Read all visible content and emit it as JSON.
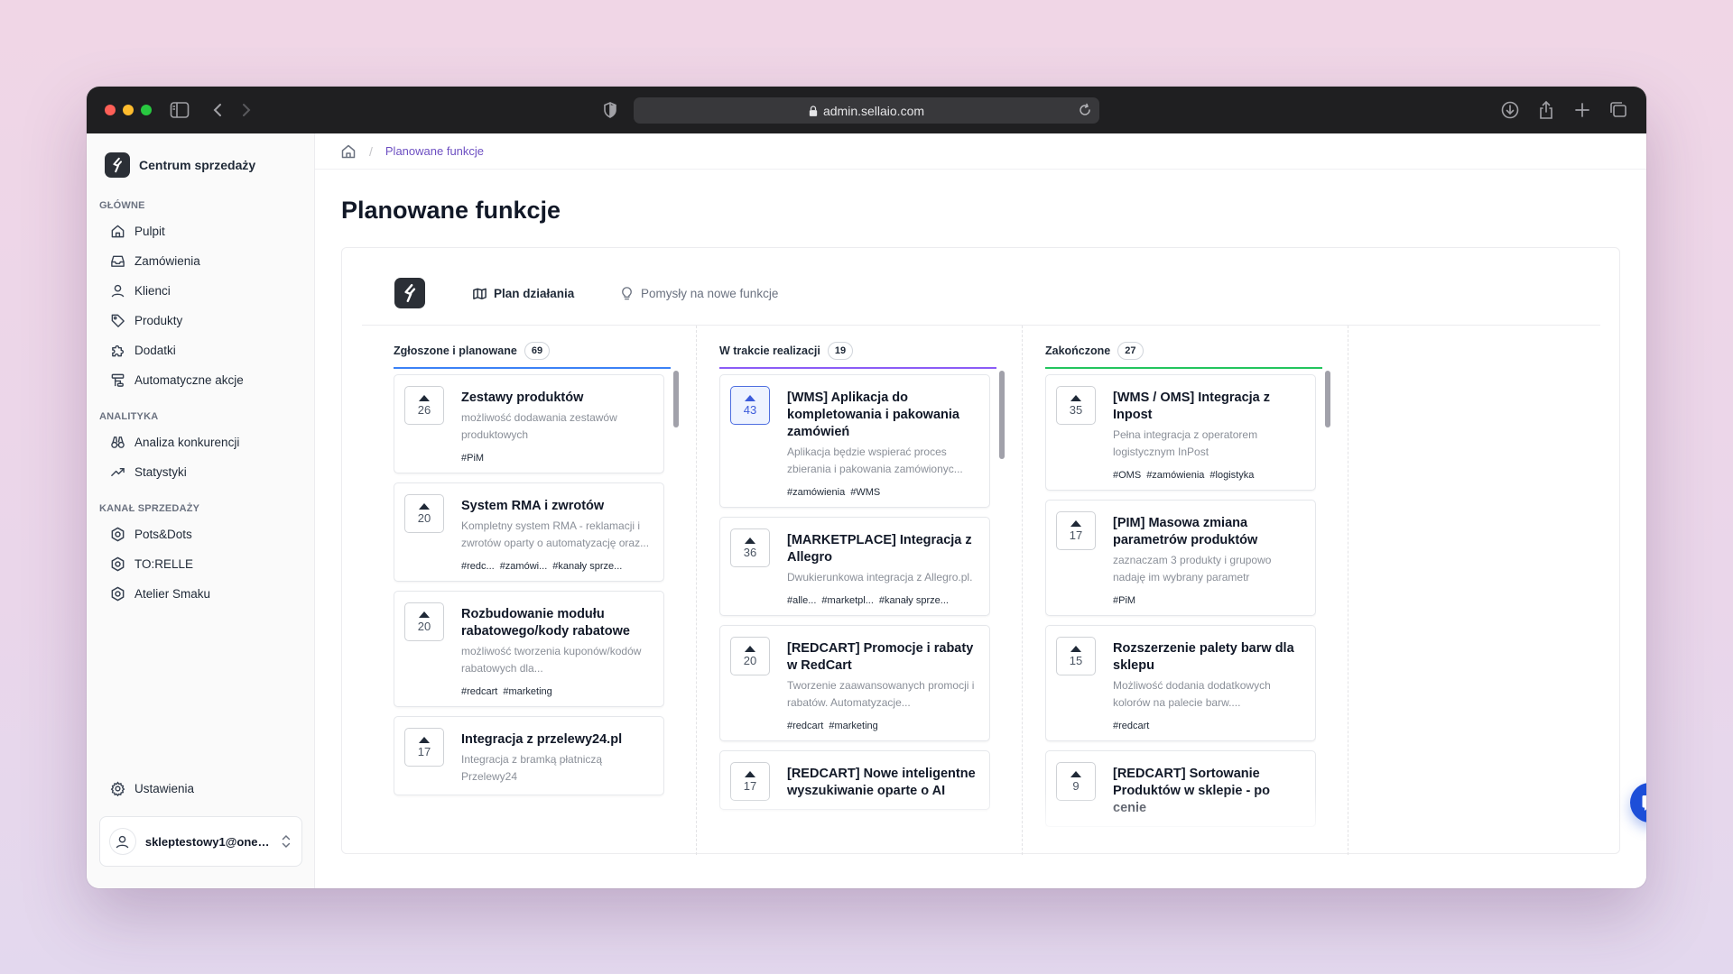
{
  "browser": {
    "url": "admin.sellaio.com"
  },
  "sidebar": {
    "brand": "Centrum sprzedaży",
    "sections": [
      {
        "label": "GŁÓWNE",
        "items": [
          {
            "label": "Pulpit",
            "icon": "home-icon"
          },
          {
            "label": "Zamówienia",
            "icon": "inbox-icon"
          },
          {
            "label": "Klienci",
            "icon": "user-icon"
          },
          {
            "label": "Produkty",
            "icon": "tag-icon"
          },
          {
            "label": "Dodatki",
            "icon": "puzzle-icon"
          },
          {
            "label": "Automatyczne akcje",
            "icon": "workflow-icon"
          }
        ]
      },
      {
        "label": "ANALITYKA",
        "items": [
          {
            "label": "Analiza konkurencji",
            "icon": "binoculars-icon"
          },
          {
            "label": "Statystyki",
            "icon": "trend-icon"
          }
        ]
      },
      {
        "label": "KANAŁ SPRZEDAŻY",
        "items": [
          {
            "label": "Pots&Dots",
            "icon": "channel-icon"
          },
          {
            "label": "TO:RELLE",
            "icon": "channel-icon"
          },
          {
            "label": "Atelier Smaku",
            "icon": "channel-icon"
          }
        ]
      }
    ],
    "settings": "Ustawienia",
    "user_email": "skleptestowy1@onet.pl"
  },
  "breadcrumb": {
    "current": "Planowane funkcje"
  },
  "page": {
    "title": "Planowane funkcje",
    "tabs": {
      "roadmap": "Plan działania",
      "ideas": "Pomysły na nowe funkcje"
    }
  },
  "columns": [
    {
      "title": "Zgłoszone i planowane",
      "count": "69",
      "accent": "#3b82f6",
      "cards": [
        {
          "votes": "26",
          "title": "Zestawy produktów",
          "desc": "możliwość dodawania zestawów produktowych",
          "tags": [
            "#PiM"
          ]
        },
        {
          "votes": "20",
          "title": "System RMA i zwrotów",
          "desc": "Kompletny system RMA - reklamacji i zwrotów oparty o automatyzację oraz...",
          "tags": [
            "#redc...",
            "#zamówi...",
            "#kanały sprze..."
          ]
        },
        {
          "votes": "20",
          "title": "Rozbudowanie modułu rabatowego/kody rabatowe",
          "desc": "możliwość tworzenia kuponów/kodów rabatowych dla...",
          "tags": [
            "#redcart",
            "#marketing"
          ]
        },
        {
          "votes": "17",
          "title": "Integracja z przelewy24.pl",
          "desc": "Integracja z bramką płatniczą Przelewy24",
          "tags": []
        }
      ]
    },
    {
      "title": "W trakcie realizacji",
      "count": "19",
      "accent": "#8b5cf6",
      "cards": [
        {
          "votes": "43",
          "voted": true,
          "title": "[WMS] Aplikacja do kompletowania i pakowania zamówień",
          "desc": "Aplikacja będzie wspierać proces zbierania i pakowania zamówionyc...",
          "tags": [
            "#zamówienia",
            "#WMS"
          ]
        },
        {
          "votes": "36",
          "title": "[MARKETPLACE] Integracja z Allegro",
          "desc": "Dwukierunkowa integracja z Allegro.pl.",
          "tags": [
            "#alle...",
            "#marketpl...",
            "#kanały sprze..."
          ]
        },
        {
          "votes": "20",
          "title": "[REDCART] Promocje i rabaty w RedCart",
          "desc": "Tworzenie zaawansowanych promocji i rabatów. Automatyzacje...",
          "tags": [
            "#redcart",
            "#marketing"
          ]
        },
        {
          "votes": "17",
          "title": "[REDCART] Nowe inteligentne wyszukiwanie oparte o AI",
          "desc": "",
          "tags": []
        }
      ]
    },
    {
      "title": "Zakończone",
      "count": "27",
      "accent": "#22c55e",
      "cards": [
        {
          "votes": "35",
          "title": "[WMS / OMS] Integracja z Inpost",
          "desc": "Pełna integracja z operatorem logistycznym InPost",
          "tags": [
            "#OMS",
            "#zamówienia",
            "#logistyka"
          ]
        },
        {
          "votes": "17",
          "title": "[PIM] Masowa zmiana parametrów produktów",
          "desc": "zaznaczam 3 produkty i grupowo nadaję im wybrany parametr",
          "tags": [
            "#PiM"
          ]
        },
        {
          "votes": "15",
          "title": "Rozszerzenie palety barw dla sklepu",
          "desc": "Możliwość dodania dodatkowych kolorów na palecie barw....",
          "tags": [
            "#redcart"
          ]
        },
        {
          "votes": "9",
          "title": "[REDCART] Sortowanie Produktów w sklepie - po cenie",
          "desc": "",
          "tags": []
        }
      ]
    }
  ]
}
